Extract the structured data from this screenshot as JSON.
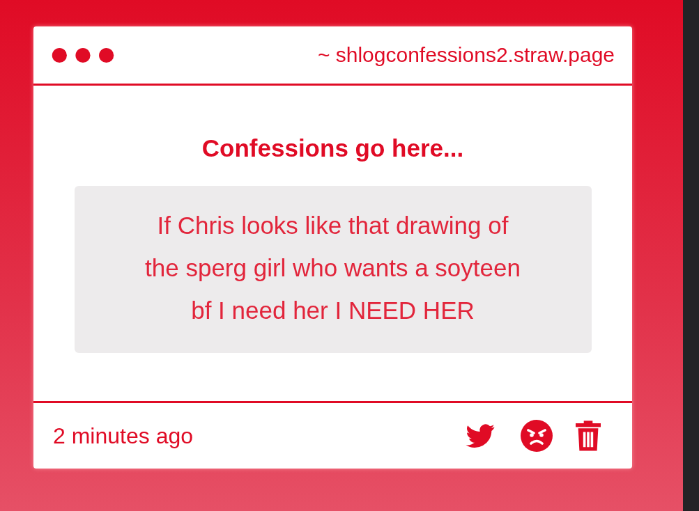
{
  "window": {
    "address": "~ shlogconfessions2.straw.page"
  },
  "heading": "Confessions go here...",
  "confession": "If Chris looks like that drawing of the sperg girl who wants a soyteen bf I need her I NEED HER",
  "footer": {
    "time": "2 minutes ago",
    "actions": [
      {
        "kind": "bird"
      },
      {
        "kind": "angry"
      },
      {
        "kind": "trash"
      }
    ]
  }
}
